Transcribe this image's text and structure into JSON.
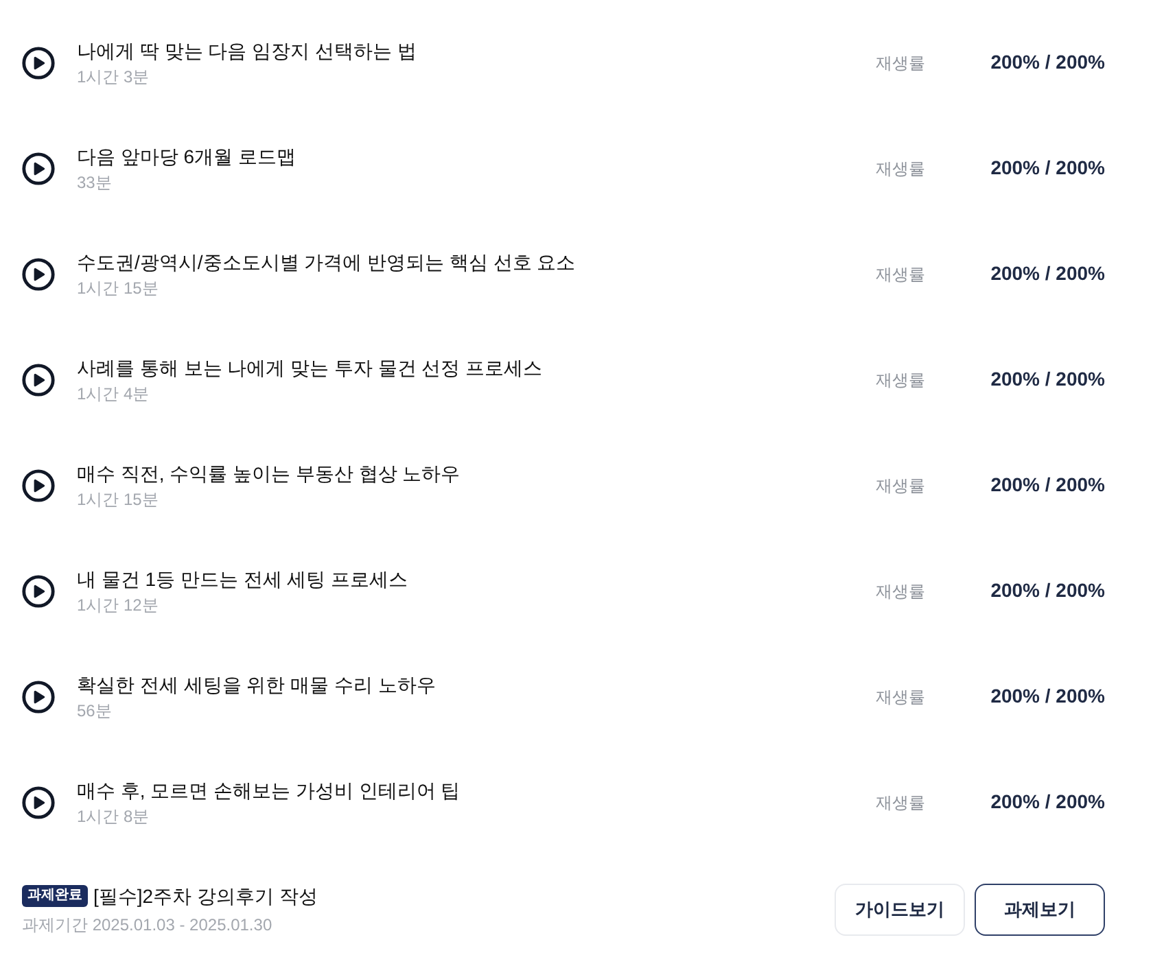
{
  "lectures": [
    {
      "title": "나에게 딱 맞는 다음 임장지 선택하는 법",
      "duration": "1시간 3분",
      "rate_label": "재생률",
      "rate": "200% / 200%"
    },
    {
      "title": "다음 앞마당 6개월 로드맵",
      "duration": "33분",
      "rate_label": "재생률",
      "rate": "200% / 200%"
    },
    {
      "title": "수도권/광역시/중소도시별 가격에 반영되는 핵심 선호 요소",
      "duration": "1시간 15분",
      "rate_label": "재생률",
      "rate": "200% / 200%"
    },
    {
      "title": "사례를 통해 보는 나에게 맞는 투자 물건 선정 프로세스",
      "duration": "1시간 4분",
      "rate_label": "재생률",
      "rate": "200% / 200%"
    },
    {
      "title": "매수 직전, 수익률 높이는 부동산 협상 노하우",
      "duration": "1시간 15분",
      "rate_label": "재생률",
      "rate": "200% / 200%"
    },
    {
      "title": "내 물건 1등 만드는 전세 세팅 프로세스",
      "duration": "1시간 12분",
      "rate_label": "재생률",
      "rate": "200% / 200%"
    },
    {
      "title": "확실한 전세 세팅을 위한 매물 수리 노하우",
      "duration": "56분",
      "rate_label": "재생률",
      "rate": "200% / 200%"
    },
    {
      "title": "매수 후, 모르면 손해보는 가성비 인테리어 팁",
      "duration": "1시간 8분",
      "rate_label": "재생률",
      "rate": "200% / 200%"
    }
  ],
  "assignment": {
    "badge": "과제완료",
    "title": "[필수]2주차 강의후기 작성",
    "period": "과제기간 2025.01.03 - 2025.01.30",
    "buttons": [
      {
        "label": "가이드보기",
        "kind": "secondary"
      },
      {
        "label": "과제보기",
        "kind": "primary"
      }
    ]
  }
}
